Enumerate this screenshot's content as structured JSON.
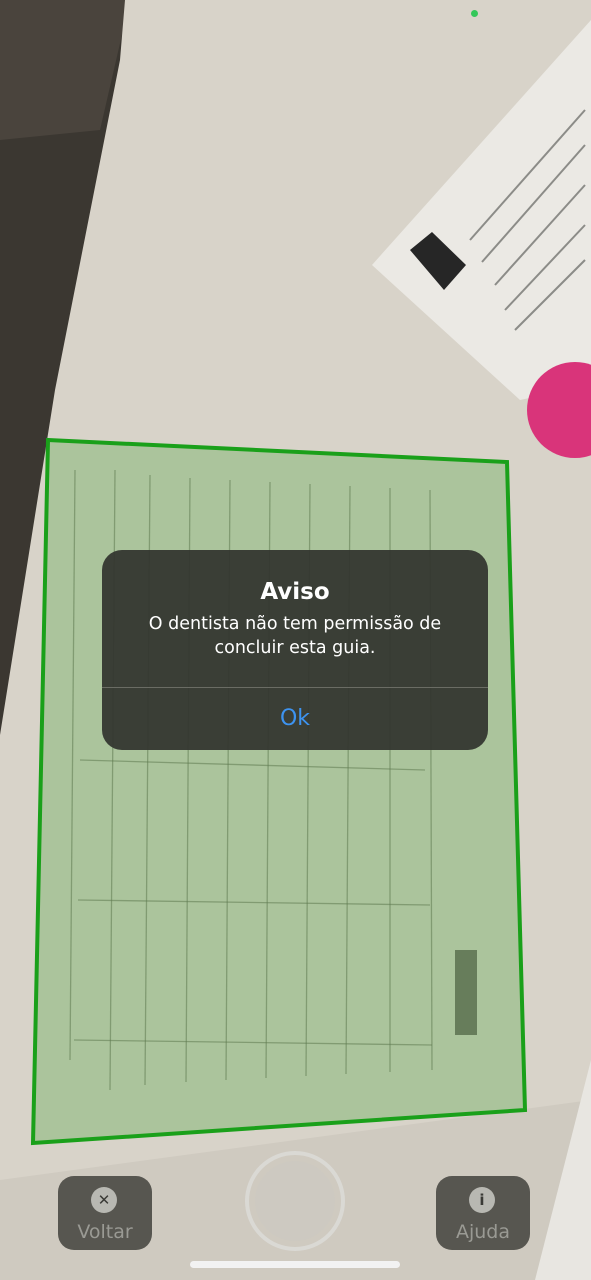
{
  "alert": {
    "title": "Aviso",
    "message": "O dentista não tem permissão de concluir esta guia.",
    "ok_label": "Ok"
  },
  "toolbar": {
    "back": {
      "label": "Voltar",
      "icon": "close-icon"
    },
    "capture": {
      "icon": "shutter-button"
    },
    "help": {
      "label": "Ajuda",
      "icon": "info-icon"
    }
  },
  "colors": {
    "detection_outline": "#1aa01a",
    "alert_action": "#3d93f0",
    "privacy_indicator": "#34c759"
  }
}
